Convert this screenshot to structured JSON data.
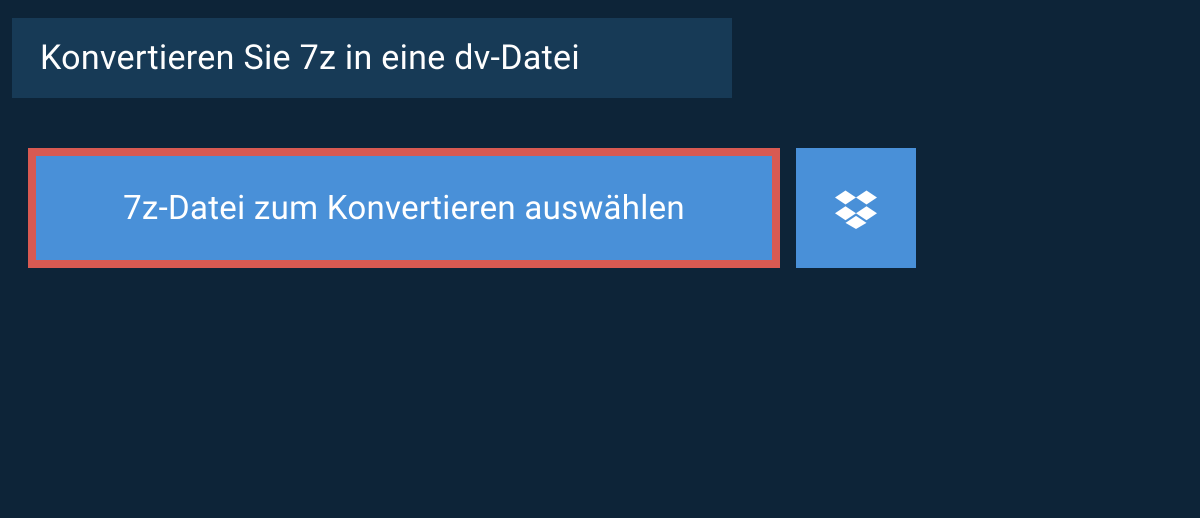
{
  "header": {
    "title": "Konvertieren Sie 7z in eine dv-Datei"
  },
  "actions": {
    "select_file_label": "7z-Datei zum Konvertieren auswählen",
    "dropbox_icon_name": "dropbox-icon"
  },
  "colors": {
    "background": "#0d2438",
    "header_bg": "#173a56",
    "button_bg": "#4990d8",
    "highlight_border": "#d85a52",
    "text": "#ffffff"
  }
}
